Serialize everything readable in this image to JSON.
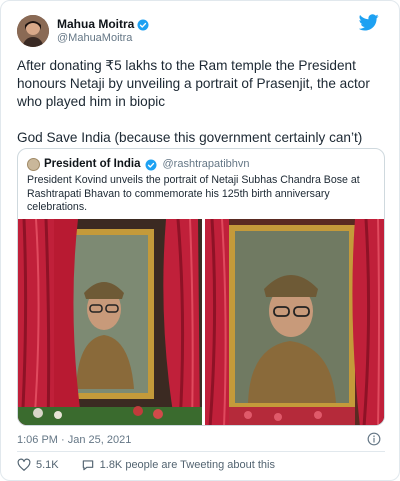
{
  "tweet": {
    "author_name": "Mahua Moitra",
    "author_handle": "@MahuaMoitra",
    "text_p1": "After donating ₹5 lakhs to the Ram temple the President honours Netaji by unveiling a portrait of Prasenjit, the actor who played him in biopic",
    "text_p2": "God Save India (because this government certainly can’t)",
    "timestamp": "1:06 PM · Jan 25, 2021",
    "likes": "5.1K",
    "retweet_text": "1.8K people are Tweeting about this"
  },
  "quoted": {
    "author_name": "President of India",
    "author_handle": "@rashtrapatibhvn",
    "text": "President Kovind unveils the portrait of Netaji Subhas Chandra Bose at Rashtrapati Bhavan to commemorate his 125th birth anniversary celebrations."
  },
  "icons": {
    "brand": "twitter-bird-icon",
    "verified": "verified-badge-icon",
    "info": "info-icon",
    "like": "heart-icon",
    "retweet": "comment-icon"
  },
  "colors": {
    "twitter_blue": "#1da1f2",
    "text": "#0f1419",
    "muted": "#657786",
    "border": "#e1e8ed"
  }
}
